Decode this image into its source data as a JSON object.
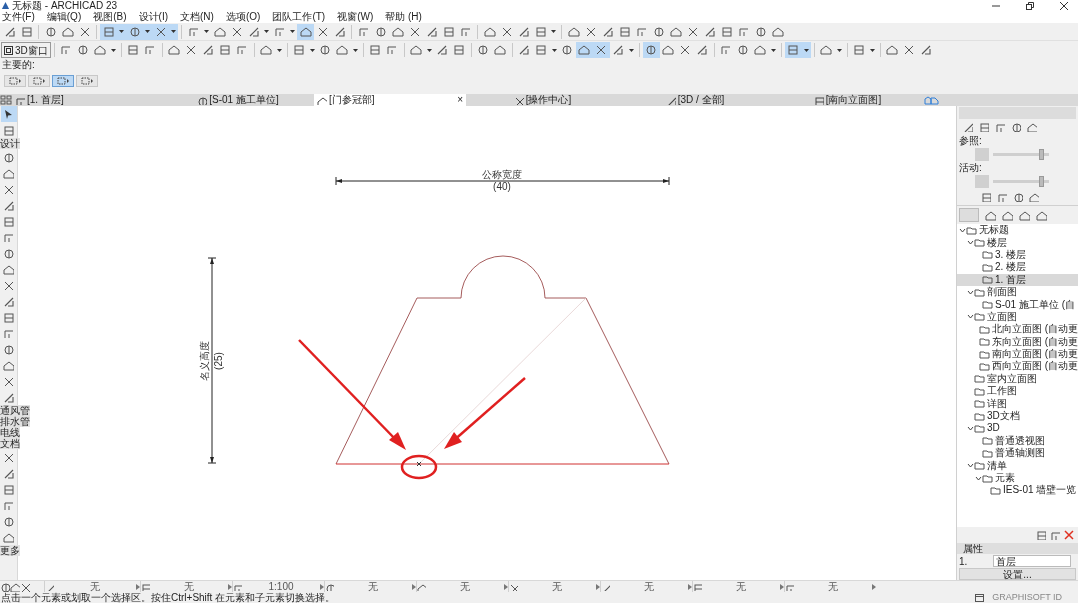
{
  "window": {
    "title": "无标题 - ARCHICAD 23"
  },
  "menu": [
    "文件(F)",
    "编辑(Q)",
    "视图(B)",
    "设计(I)",
    "文档(N)",
    "选项(O)",
    "团队工作(T)",
    "视窗(W)",
    "帮助 (H)"
  ],
  "toolbar_1": [
    {
      "kind": "tool",
      "selected": false
    },
    {
      "kind": "tool",
      "selected": false
    },
    {
      "kind": "sep"
    },
    {
      "kind": "tool",
      "selected": false
    },
    {
      "kind": "tool",
      "selected": false
    },
    {
      "kind": "tool",
      "selected": false
    },
    {
      "kind": "sep"
    },
    {
      "kind": "tool",
      "selected": true
    },
    {
      "kind": "menu",
      "selected": true
    },
    {
      "kind": "tool",
      "selected": true
    },
    {
      "kind": "menu",
      "selected": true
    },
    {
      "kind": "tool",
      "selected": true
    },
    {
      "kind": "menu",
      "selected": true
    },
    {
      "kind": "sep"
    },
    {
      "kind": "tool",
      "selected": false
    },
    {
      "kind": "menu",
      "selected": false
    },
    {
      "kind": "tool",
      "selected": false
    },
    {
      "kind": "tool",
      "selected": false
    },
    {
      "kind": "tool",
      "selected": false
    },
    {
      "kind": "menu",
      "selected": false
    },
    {
      "kind": "tool",
      "selected": false
    },
    {
      "kind": "menu",
      "selected": false
    },
    {
      "kind": "tool",
      "selected": true
    },
    {
      "kind": "tool",
      "selected": false
    },
    {
      "kind": "tool",
      "selected": false
    },
    {
      "kind": "sep"
    },
    {
      "kind": "tool",
      "selected": false
    },
    {
      "kind": "tool",
      "selected": false
    },
    {
      "kind": "tool",
      "selected": false
    },
    {
      "kind": "tool",
      "selected": false
    },
    {
      "kind": "tool",
      "selected": false
    },
    {
      "kind": "tool",
      "selected": false
    },
    {
      "kind": "tool",
      "selected": false
    },
    {
      "kind": "sep"
    },
    {
      "kind": "tool",
      "selected": false
    },
    {
      "kind": "tool",
      "selected": false
    },
    {
      "kind": "tool",
      "selected": false
    },
    {
      "kind": "tool",
      "selected": false
    },
    {
      "kind": "menu",
      "selected": false
    },
    {
      "kind": "sep"
    },
    {
      "kind": "tool",
      "selected": false
    },
    {
      "kind": "tool",
      "selected": false
    },
    {
      "kind": "tool",
      "selected": false
    },
    {
      "kind": "tool",
      "selected": false
    },
    {
      "kind": "tool",
      "selected": false
    },
    {
      "kind": "tool",
      "selected": false
    },
    {
      "kind": "tool",
      "selected": false
    },
    {
      "kind": "tool",
      "selected": false
    },
    {
      "kind": "tool",
      "selected": false
    },
    {
      "kind": "tool",
      "selected": false
    },
    {
      "kind": "tool",
      "selected": false
    },
    {
      "kind": "tool",
      "selected": false
    },
    {
      "kind": "tool",
      "selected": false
    }
  ],
  "toolbar_2": [
    {
      "kind": "button",
      "label": "3D窗口"
    },
    {
      "kind": "sep"
    },
    {
      "kind": "tool",
      "selected": false
    },
    {
      "kind": "tool",
      "selected": false
    },
    {
      "kind": "tool",
      "selected": false
    },
    {
      "kind": "menu",
      "selected": false
    },
    {
      "kind": "sep"
    },
    {
      "kind": "tool",
      "selected": false
    },
    {
      "kind": "tool",
      "selected": false
    },
    {
      "kind": "sep"
    },
    {
      "kind": "tool",
      "selected": false
    },
    {
      "kind": "tool",
      "selected": false
    },
    {
      "kind": "tool",
      "selected": false
    },
    {
      "kind": "tool",
      "selected": false
    },
    {
      "kind": "tool",
      "selected": false
    },
    {
      "kind": "sep"
    },
    {
      "kind": "tool",
      "selected": false
    },
    {
      "kind": "menu",
      "selected": false
    },
    {
      "kind": "sep"
    },
    {
      "kind": "tool",
      "selected": false
    },
    {
      "kind": "menu",
      "selected": false
    },
    {
      "kind": "tool",
      "selected": false
    },
    {
      "kind": "tool",
      "selected": false
    },
    {
      "kind": "menu",
      "selected": false
    },
    {
      "kind": "sep"
    },
    {
      "kind": "tool",
      "selected": false
    },
    {
      "kind": "tool",
      "selected": false
    },
    {
      "kind": "sep"
    },
    {
      "kind": "tool",
      "selected": false
    },
    {
      "kind": "menu",
      "selected": false
    },
    {
      "kind": "tool",
      "selected": false
    },
    {
      "kind": "tool",
      "selected": false
    },
    {
      "kind": "sep"
    },
    {
      "kind": "tool",
      "selected": false
    },
    {
      "kind": "tool",
      "selected": false
    },
    {
      "kind": "sep"
    },
    {
      "kind": "tool",
      "selected": false
    },
    {
      "kind": "tool",
      "selected": false
    },
    {
      "kind": "menu",
      "selected": false
    },
    {
      "kind": "tool",
      "selected": false
    },
    {
      "kind": "tool",
      "selected": true
    },
    {
      "kind": "tool",
      "selected": true
    },
    {
      "kind": "tool",
      "selected": false
    },
    {
      "kind": "menu",
      "selected": false
    },
    {
      "kind": "sep"
    },
    {
      "kind": "tool",
      "selected": true
    },
    {
      "kind": "tool",
      "selected": false
    },
    {
      "kind": "tool",
      "selected": false
    },
    {
      "kind": "tool",
      "selected": false
    },
    {
      "kind": "sep"
    },
    {
      "kind": "tool",
      "selected": false
    },
    {
      "kind": "tool",
      "selected": false
    },
    {
      "kind": "tool",
      "selected": false
    },
    {
      "kind": "menu",
      "selected": false
    },
    {
      "kind": "sep"
    },
    {
      "kind": "tool",
      "selected": true
    },
    {
      "kind": "menu",
      "selected": true
    },
    {
      "kind": "sep"
    },
    {
      "kind": "tool",
      "selected": false
    },
    {
      "kind": "menu",
      "selected": false
    },
    {
      "kind": "sep"
    },
    {
      "kind": "tool",
      "selected": false
    },
    {
      "kind": "menu",
      "selected": false
    },
    {
      "kind": "sep"
    },
    {
      "kind": "tool",
      "selected": false
    },
    {
      "kind": "tool",
      "selected": false
    },
    {
      "kind": "tool",
      "selected": false
    }
  ],
  "infobox": {
    "label": "主要的:",
    "tools": [
      {
        "selected": false
      },
      {
        "selected": false
      },
      {
        "selected": true
      },
      {
        "selected": false
      }
    ]
  },
  "tabs": [
    {
      "label": "[1. 首层]",
      "selected": false
    },
    {
      "label": "[S-01 施工单位]",
      "selected": false
    },
    {
      "label": "[门参冠部]",
      "selected": true,
      "close": "×"
    },
    {
      "label": "[操作中心]",
      "selected": false
    },
    {
      "label": "[3D / 全部]",
      "selected": false
    },
    {
      "label": "[南向立面图]",
      "selected": false
    }
  ],
  "toolbox": [
    {
      "kind": "tool",
      "selected": true
    },
    {
      "kind": "tool",
      "selected": false
    },
    {
      "kind": "label",
      "label": "设计"
    },
    {
      "kind": "tool",
      "selected": false
    },
    {
      "kind": "tool",
      "selected": false
    },
    {
      "kind": "tool",
      "selected": false
    },
    {
      "kind": "tool",
      "selected": false
    },
    {
      "kind": "tool",
      "selected": false
    },
    {
      "kind": "tool",
      "selected": false
    },
    {
      "kind": "tool",
      "selected": false
    },
    {
      "kind": "tool",
      "selected": false
    },
    {
      "kind": "tool",
      "selected": false
    },
    {
      "kind": "tool",
      "selected": false
    },
    {
      "kind": "tool",
      "selected": false
    },
    {
      "kind": "tool",
      "selected": false
    },
    {
      "kind": "tool",
      "selected": false
    },
    {
      "kind": "tool",
      "selected": false
    },
    {
      "kind": "tool",
      "selected": false
    },
    {
      "kind": "tool",
      "selected": false
    },
    {
      "kind": "label",
      "label": "通风管"
    },
    {
      "kind": "label",
      "label": "排水管"
    },
    {
      "kind": "label",
      "label": "电线"
    },
    {
      "kind": "label",
      "label": "文档"
    },
    {
      "kind": "tool",
      "selected": false
    },
    {
      "kind": "tool",
      "selected": false
    },
    {
      "kind": "tool",
      "selected": false
    },
    {
      "kind": "tool",
      "selected": false
    },
    {
      "kind": "tool",
      "selected": false
    },
    {
      "kind": "tool",
      "selected": false
    },
    {
      "kind": "label",
      "label": "更多"
    }
  ],
  "drawing": {
    "width_label": "公称宽度",
    "width_value": "(40)",
    "height_label": "名义高度",
    "height_value": "(25)"
  },
  "navigator": {
    "reference": {
      "label": "参照:",
      "level": 0.9
    },
    "active": {
      "label": "活动:",
      "level": 0.9
    },
    "tree": [
      {
        "label": "无标题",
        "expanded": true,
        "selected": false,
        "children": [
          {
            "label": "楼层",
            "expanded": true,
            "selected": false,
            "children": [
              {
                "label": "3. 楼层",
                "selected": false
              },
              {
                "label": "2. 楼层",
                "selected": false
              },
              {
                "label": "1. 首层",
                "selected": true
              }
            ]
          },
          {
            "label": "剖面图",
            "expanded": true,
            "selected": false,
            "children": [
              {
                "label": "S-01 施工单位 (自",
                "selected": false
              }
            ]
          },
          {
            "label": "立面图",
            "expanded": true,
            "selected": false,
            "children": [
              {
                "label": "北向立面图 (自动更",
                "selected": false
              },
              {
                "label": "东向立面图 (自动更",
                "selected": false
              },
              {
                "label": "南向立面图 (自动更",
                "selected": false
              },
              {
                "label": "西向立面图 (自动更",
                "selected": false
              }
            ]
          },
          {
            "label": "室内立面图",
            "selected": false
          },
          {
            "label": "工作图",
            "selected": false
          },
          {
            "label": "详图",
            "selected": false
          },
          {
            "label": "3D文档",
            "selected": false
          },
          {
            "label": "3D",
            "expanded": true,
            "selected": false,
            "children": [
              {
                "label": "普通透视图",
                "selected": false
              },
              {
                "label": "普通轴测图",
                "selected": false
              }
            ]
          },
          {
            "label": "清单",
            "expanded": true,
            "selected": false,
            "children": [
              {
                "label": "元素",
                "expanded": true,
                "selected": false,
                "children": [
                  {
                    "label": "IES-01 墙壁一览",
                    "selected": false
                  }
                ]
              }
            ]
          }
        ]
      }
    ],
    "properties": {
      "title": "属性",
      "id": "1.",
      "name": "首层",
      "settings": "设置..."
    },
    "footer": "GRAPHISOFT ID"
  },
  "quick_options": [
    {
      "value": "无"
    },
    {
      "value": "无"
    },
    {
      "value": "1:100"
    },
    {
      "value": "无"
    },
    {
      "value": "无"
    },
    {
      "value": "无"
    },
    {
      "value": "无"
    },
    {
      "value": "无"
    },
    {
      "value": "无"
    }
  ],
  "status_bar": "点击一个元素或划取一个选择区。按住Ctrl+Shift 在元素和子元素切换选择。"
}
